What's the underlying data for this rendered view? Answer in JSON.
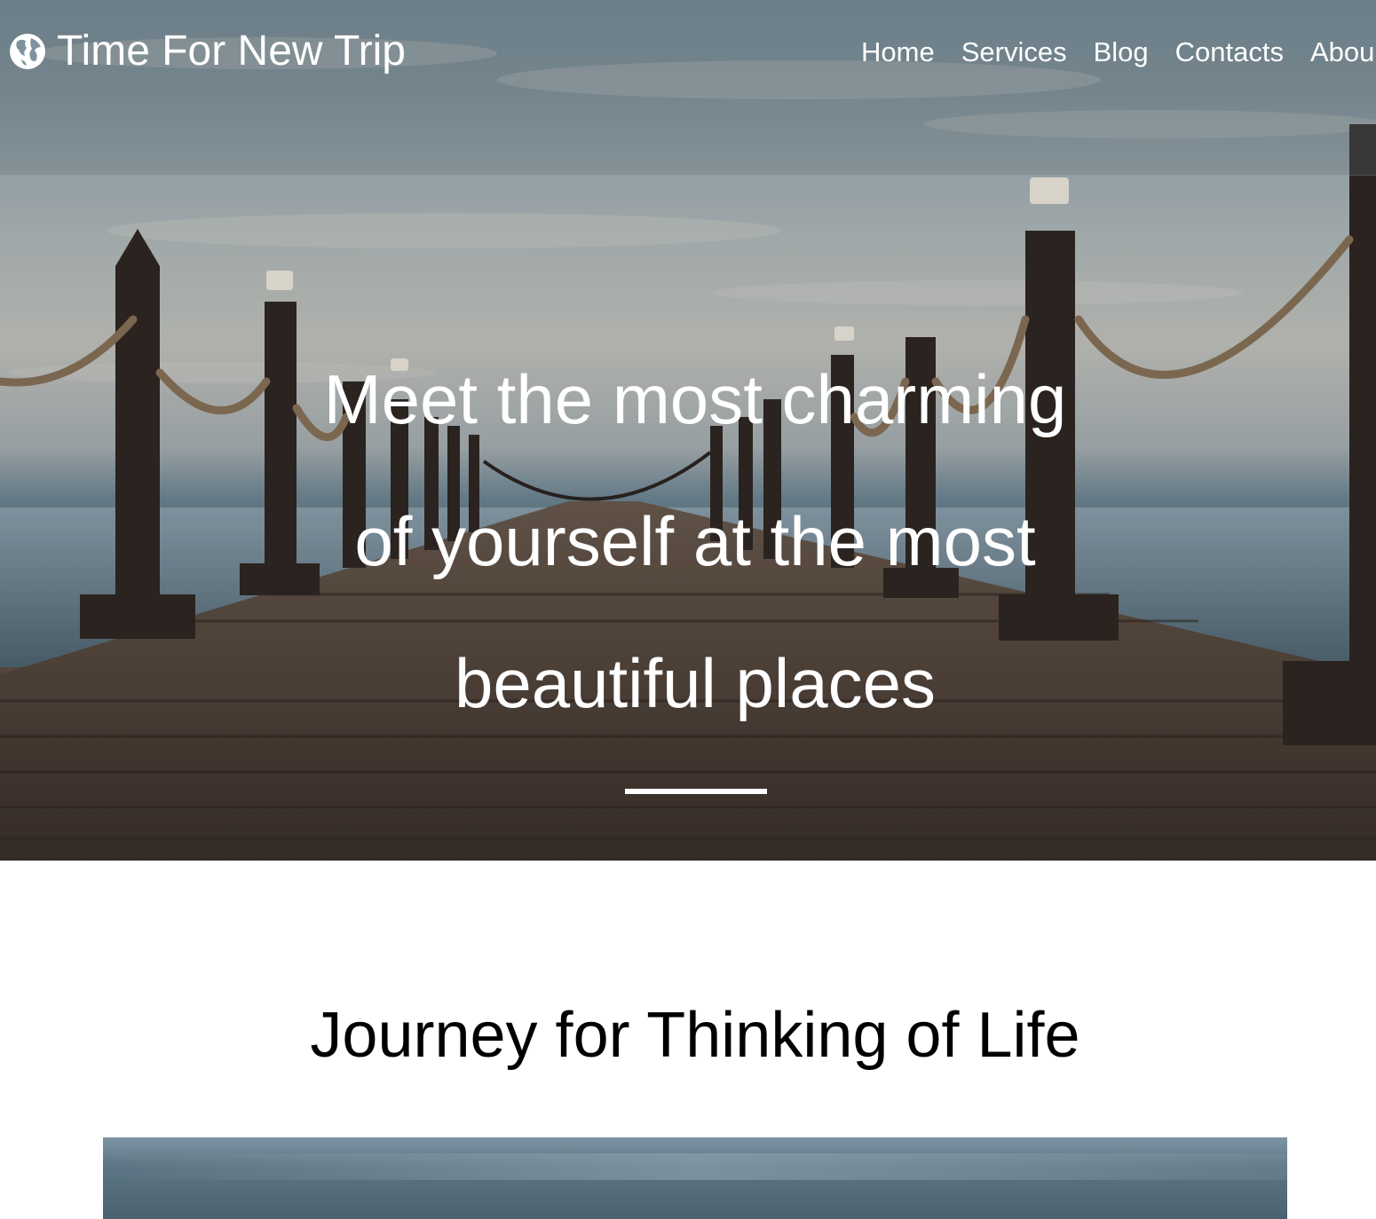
{
  "brand": {
    "icon": "globe-icon",
    "name": "Time For New Trip"
  },
  "nav": {
    "items": [
      {
        "label": "Home"
      },
      {
        "label": "Services"
      },
      {
        "label": "Blog"
      },
      {
        "label": "Contacts"
      },
      {
        "label": "Abou"
      }
    ]
  },
  "hero": {
    "lines": [
      "Meet the most charming",
      "of yourself at the most",
      "beautiful places"
    ]
  },
  "section": {
    "title": "Journey for Thinking of Life"
  },
  "colors": {
    "text_light": "#ffffff",
    "text_dark": "#000000",
    "background": "#ffffff"
  }
}
